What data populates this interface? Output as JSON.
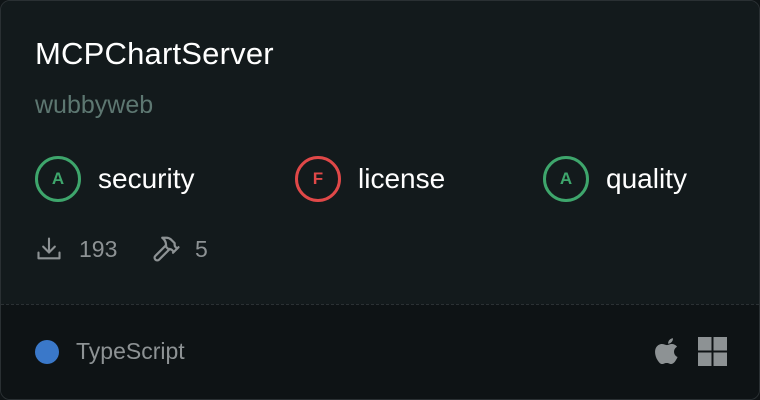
{
  "card": {
    "title": "MCPChartServer",
    "author": "wubbyweb",
    "grades": [
      {
        "letter": "A",
        "label": "security",
        "color": "#3ea66c"
      },
      {
        "letter": "F",
        "label": "license",
        "color": "#e04848"
      },
      {
        "letter": "A",
        "label": "quality",
        "color": "#3ea66c"
      }
    ],
    "stats": {
      "downloads": "193",
      "downloads_icon": "download-icon",
      "tools": "5",
      "tools_icon": "hammer-icon"
    },
    "language": {
      "name": "TypeScript",
      "color": "#3a78c9"
    },
    "platforms": [
      "apple-icon",
      "windows-icon"
    ]
  }
}
